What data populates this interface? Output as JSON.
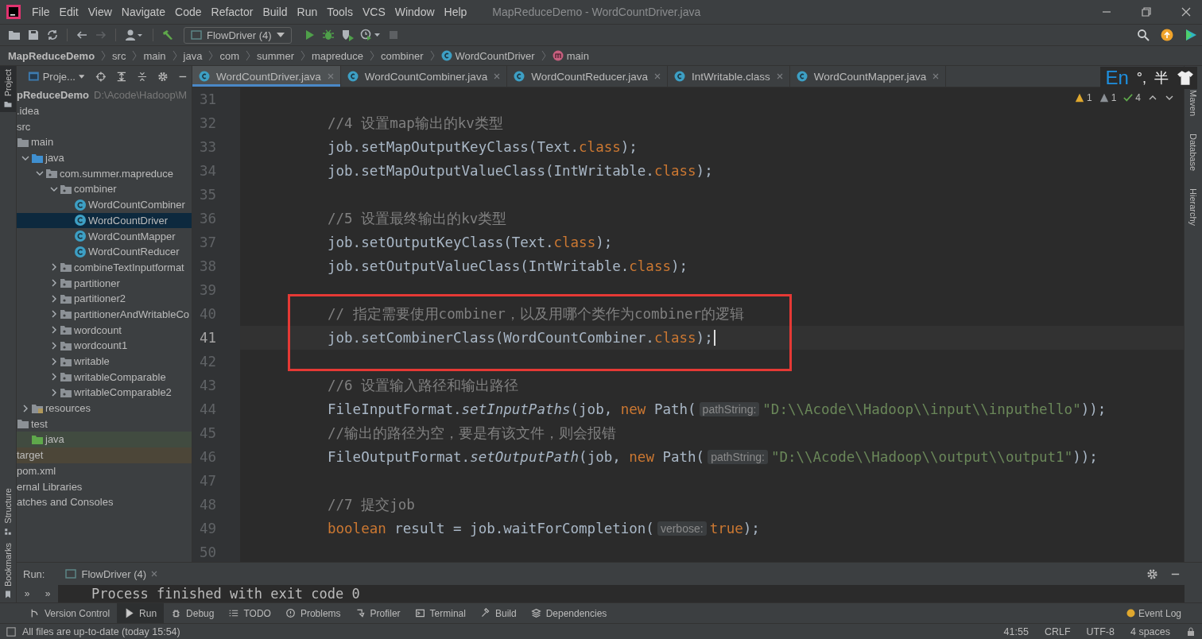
{
  "menu": [
    "File",
    "Edit",
    "View",
    "Navigate",
    "Code",
    "Refactor",
    "Build",
    "Run",
    "Tools",
    "VCS",
    "Window",
    "Help"
  ],
  "window": {
    "title": "MapReduceDemo - WordCountDriver.java"
  },
  "run_config": "FlowDriver (4)",
  "breadcrumb": [
    "MapReduceDemo",
    "src",
    "main",
    "java",
    "com",
    "summer",
    "mapreduce",
    "combiner",
    "WordCountDriver",
    "main"
  ],
  "left_stripe": [
    {
      "label": "Project",
      "selected": true
    },
    {
      "label": "Structure",
      "selected": false
    },
    {
      "label": "Bookmarks",
      "selected": false
    }
  ],
  "project_panel": {
    "title": "Proje..."
  },
  "project_tree": {
    "root": {
      "name": "pReduceDemo",
      "path": "D:\\Acode\\Hadoop\\M"
    },
    "items": [
      {
        "name": ".idea",
        "kind": "folder",
        "selected": false
      },
      {
        "name": "src",
        "kind": "folder",
        "selected": false,
        "children": [
          {
            "name": "main",
            "kind": "folder",
            "selected": false,
            "children": [
              {
                "name": "java",
                "kind": "source",
                "selected": false,
                "expanded": true,
                "children": [
                  {
                    "name": "com.summer.mapreduce",
                    "kind": "package",
                    "selected": false,
                    "expanded": true,
                    "children": [
                      {
                        "name": "combiner",
                        "kind": "package",
                        "selected": false,
                        "expanded": true,
                        "children": [
                          {
                            "name": "WordCountCombiner",
                            "kind": "class",
                            "selected": false
                          },
                          {
                            "name": "WordCountDriver",
                            "kind": "class",
                            "selected": true
                          },
                          {
                            "name": "WordCountMapper",
                            "kind": "class",
                            "selected": false
                          },
                          {
                            "name": "WordCountReducer",
                            "kind": "class",
                            "selected": false
                          }
                        ]
                      },
                      {
                        "name": "combineTextInputformat",
                        "kind": "package",
                        "selected": false,
                        "expanded": false
                      },
                      {
                        "name": "partitioner",
                        "kind": "package",
                        "selected": false,
                        "expanded": false
                      },
                      {
                        "name": "partitioner2",
                        "kind": "package",
                        "selected": false,
                        "expanded": false
                      },
                      {
                        "name": "partitionerAndWritableCo",
                        "kind": "package",
                        "selected": false,
                        "expanded": false
                      },
                      {
                        "name": "wordcount",
                        "kind": "package",
                        "selected": false,
                        "expanded": false
                      },
                      {
                        "name": "wordcount1",
                        "kind": "package",
                        "selected": false,
                        "expanded": false
                      },
                      {
                        "name": "writable",
                        "kind": "package",
                        "selected": false,
                        "expanded": false
                      },
                      {
                        "name": "writableComparable",
                        "kind": "package",
                        "selected": false,
                        "expanded": false
                      },
                      {
                        "name": "writableComparable2",
                        "kind": "package",
                        "selected": false,
                        "expanded": false
                      }
                    ]
                  }
                ]
              },
              {
                "name": "resources",
                "kind": "resources",
                "selected": false,
                "expanded": false
              }
            ]
          },
          {
            "name": "test",
            "kind": "folder",
            "selected": false,
            "children": [
              {
                "name": "java",
                "kind": "test-source",
                "selected": false
              }
            ]
          }
        ]
      },
      {
        "name": "target",
        "kind": "excluded",
        "selected": false
      },
      {
        "name": "pom.xml",
        "kind": "file",
        "selected": false
      },
      {
        "name": "ernal Libraries",
        "kind": "library",
        "selected": false
      },
      {
        "name": "atches and Consoles",
        "kind": "scratch",
        "selected": false
      }
    ]
  },
  "tabs": [
    {
      "label": "WordCountDriver.java",
      "selected": true
    },
    {
      "label": "WordCountCombiner.java",
      "selected": false
    },
    {
      "label": "WordCountReducer.java",
      "selected": false
    },
    {
      "label": "IntWritable.class",
      "selected": false
    },
    {
      "label": "WordCountMapper.java",
      "selected": false
    }
  ],
  "ime": [
    "En",
    "°,",
    "半"
  ],
  "inspections": {
    "warnings": "1",
    "weak_warnings": "1",
    "typos": "4"
  },
  "right_stripe": [
    "Maven",
    "Database",
    "Hierarchy"
  ],
  "code": [
    {
      "n": "31",
      "current": false,
      "boxed": false
    },
    {
      "n": "32",
      "current": false,
      "boxed": false,
      "tokens": [
        {
          "t": "//4 设置map输出的kv类型",
          "kind": "comment"
        }
      ]
    },
    {
      "n": "33",
      "current": false,
      "boxed": false,
      "tokens": [
        {
          "t": "job.setMapOutputKeyClass(Text.",
          "kind": "plain"
        },
        {
          "t": "class",
          "kind": "keyword"
        },
        {
          "t": ");",
          "kind": "plain"
        }
      ]
    },
    {
      "n": "34",
      "current": false,
      "boxed": false,
      "tokens": [
        {
          "t": "job.setMapOutputValueClass(IntWritable.",
          "kind": "plain"
        },
        {
          "t": "class",
          "kind": "keyword"
        },
        {
          "t": ");",
          "kind": "plain"
        }
      ]
    },
    {
      "n": "35",
      "current": false,
      "boxed": false
    },
    {
      "n": "36",
      "current": false,
      "boxed": false,
      "tokens": [
        {
          "t": "//5 设置最终输出的kv类型",
          "kind": "comment"
        }
      ]
    },
    {
      "n": "37",
      "current": false,
      "boxed": false,
      "tokens": [
        {
          "t": "job.setOutputKeyClass(Text.",
          "kind": "plain"
        },
        {
          "t": "class",
          "kind": "keyword"
        },
        {
          "t": ");",
          "kind": "plain"
        }
      ]
    },
    {
      "n": "38",
      "current": false,
      "boxed": false,
      "tokens": [
        {
          "t": "job.setOutputValueClass(IntWritable.",
          "kind": "plain"
        },
        {
          "t": "class",
          "kind": "keyword"
        },
        {
          "t": ");",
          "kind": "plain"
        }
      ]
    },
    {
      "n": "39",
      "current": false,
      "boxed": false
    },
    {
      "n": "40",
      "current": false,
      "boxed": true,
      "tokens": [
        {
          "t": "// 指定需要使用combiner，以及用哪个类作为combiner的逻辑",
          "kind": "comment"
        }
      ]
    },
    {
      "n": "41",
      "current": true,
      "boxed": true,
      "tokens": [
        {
          "t": "job.setCombinerClass(WordCountCombiner.",
          "kind": "plain"
        },
        {
          "t": "class",
          "kind": "keyword"
        },
        {
          "t": ");",
          "kind": "plain"
        }
      ]
    },
    {
      "n": "42",
      "current": false,
      "boxed": false
    },
    {
      "n": "43",
      "current": false,
      "boxed": false,
      "tokens": [
        {
          "t": "//6 设置输入路径和输出路径",
          "kind": "comment"
        }
      ]
    },
    {
      "n": "44",
      "current": false,
      "boxed": false,
      "tokens": [
        {
          "t": "FileInputFormat.",
          "kind": "plain"
        },
        {
          "t": "setInputPaths",
          "kind": "static"
        },
        {
          "t": "(job, ",
          "kind": "plain"
        },
        {
          "t": "new ",
          "kind": "keyword"
        },
        {
          "t": "Path(",
          "kind": "plain"
        },
        {
          "t": "pathString:",
          "kind": "hint"
        },
        {
          "t": "\"D:\\\\Acode\\\\Hadoop\\\\input\\\\inputhello\"",
          "kind": "string"
        },
        {
          "t": "));",
          "kind": "plain"
        }
      ]
    },
    {
      "n": "45",
      "current": false,
      "boxed": false,
      "tokens": [
        {
          "t": "//输出的路径为空，要是有该文件，则会报错",
          "kind": "comment"
        }
      ]
    },
    {
      "n": "46",
      "current": false,
      "boxed": false,
      "tokens": [
        {
          "t": "FileOutputFormat.",
          "kind": "plain"
        },
        {
          "t": "setOutputPath",
          "kind": "static"
        },
        {
          "t": "(job, ",
          "kind": "plain"
        },
        {
          "t": "new ",
          "kind": "keyword"
        },
        {
          "t": "Path(",
          "kind": "plain"
        },
        {
          "t": "pathString:",
          "kind": "hint"
        },
        {
          "t": "\"D:\\\\Acode\\\\Hadoop\\\\output\\\\output1\"",
          "kind": "string"
        },
        {
          "t": "));",
          "kind": "plain"
        }
      ]
    },
    {
      "n": "47",
      "current": false,
      "boxed": false
    },
    {
      "n": "48",
      "current": false,
      "boxed": false,
      "tokens": [
        {
          "t": "//7 提交job",
          "kind": "comment"
        }
      ]
    },
    {
      "n": "49",
      "current": false,
      "boxed": false,
      "tokens": [
        {
          "t": "boolean ",
          "kind": "keyword"
        },
        {
          "t": "result = job.waitForCompletion(",
          "kind": "plain"
        },
        {
          "t": "verbose:",
          "kind": "hint"
        },
        {
          "t": "true",
          "kind": "keyword"
        },
        {
          "t": ");",
          "kind": "plain"
        }
      ]
    },
    {
      "n": "50",
      "current": false,
      "boxed": false
    }
  ],
  "run_panel": {
    "label": "Run:",
    "tab": "FlowDriver (4)",
    "side_buttons": [
      "»",
      "»"
    ],
    "output": "Process finished with exit code 0"
  },
  "tool_windows": [
    {
      "label": "Version Control",
      "selected": false
    },
    {
      "label": "Run",
      "selected": true
    },
    {
      "label": "Debug",
      "selected": false
    },
    {
      "label": "TODO",
      "selected": false
    },
    {
      "label": "Problems",
      "selected": false
    },
    {
      "label": "Profiler",
      "selected": false
    },
    {
      "label": "Terminal",
      "selected": false
    },
    {
      "label": "Build",
      "selected": false
    },
    {
      "label": "Dependencies",
      "selected": false
    }
  ],
  "event_log": "Event Log",
  "status_bar": {
    "message": "All files are up-to-date (today 15:54)",
    "items": [
      "41:55",
      "CRLF",
      "UTF-8",
      "4 spaces"
    ]
  }
}
